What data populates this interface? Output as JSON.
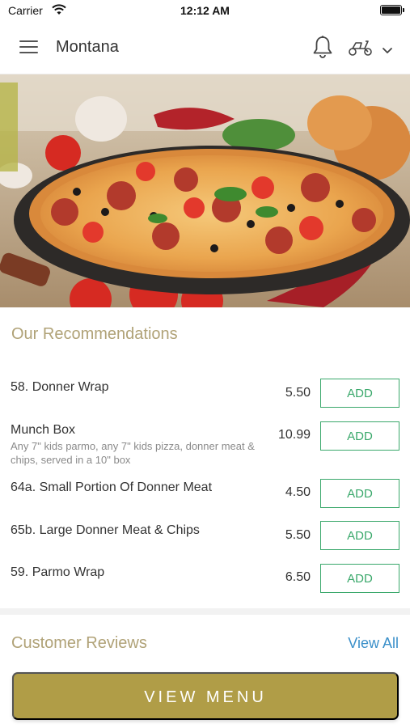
{
  "status_bar": {
    "carrier": "Carrier",
    "time": "12:12 AM"
  },
  "nav": {
    "title": "Montana",
    "icons": [
      "menu-icon",
      "bell-icon",
      "scooter-icon",
      "chevron-down-icon"
    ]
  },
  "hero": {
    "image": "pizza-photo"
  },
  "recommendations": {
    "title": "Our Recommendations",
    "add_label": "ADD",
    "items": [
      {
        "name": "58. Donner Wrap",
        "description": "",
        "price": "5.50"
      },
      {
        "name": "Munch Box",
        "description": "Any 7\" kids parmo, any 7\" kids pizza, donner meat & chips, served in a 10\" box",
        "price": "10.99"
      },
      {
        "name": "64a. Small Portion Of Donner Meat",
        "description": "",
        "price": "4.50"
      },
      {
        "name": "65b. Large Donner Meat & Chips",
        "description": "",
        "price": "5.50"
      },
      {
        "name": "59. Parmo Wrap",
        "description": "",
        "price": "6.50"
      }
    ]
  },
  "reviews": {
    "title": "Customer Reviews",
    "view_all": "View All"
  },
  "footer": {
    "view_menu": "VIEW MENU"
  },
  "colors": {
    "accent_gold": "#b09d47",
    "section_title": "#b0a277",
    "add_green": "#3aa86b",
    "link_blue": "#3a8fc9"
  }
}
